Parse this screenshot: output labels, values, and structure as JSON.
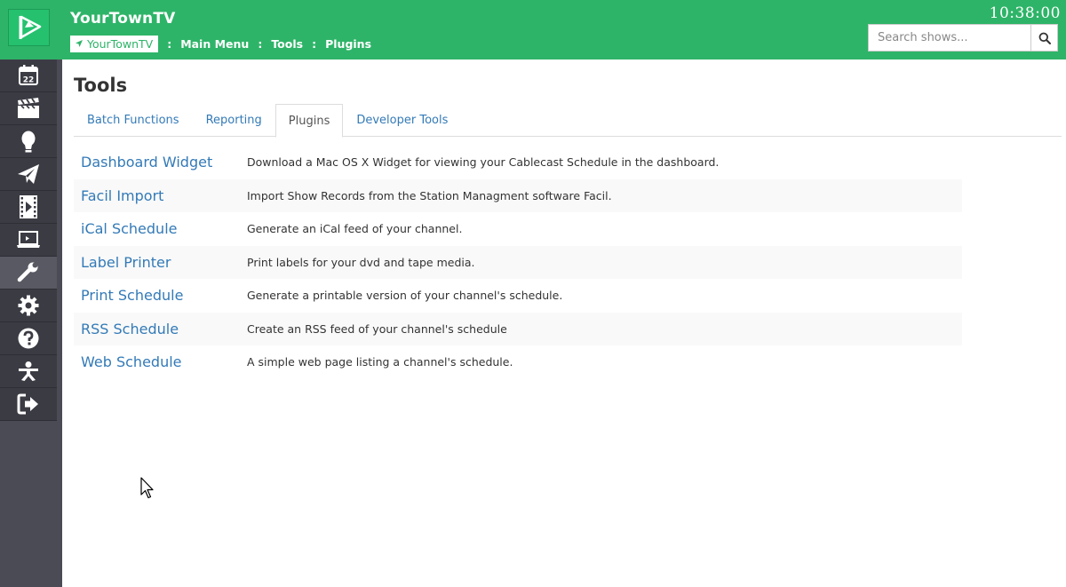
{
  "header": {
    "app_title": "YourTownTV",
    "clock": "10:38:00",
    "brand_color": "#2eb468",
    "logo_icon": "play-flag-logo-icon",
    "breadcrumb": {
      "home": "YourTownTV",
      "separator": ":",
      "items": [
        "Main Menu",
        "Tools",
        "Plugins"
      ]
    },
    "search": {
      "placeholder": "Search shows...",
      "icon": "search-icon"
    }
  },
  "sidebar": {
    "items": [
      {
        "icon": "calendar-icon",
        "calendar_day": "22",
        "active": false
      },
      {
        "icon": "clapperboard-icon",
        "active": false
      },
      {
        "icon": "person-icon",
        "active": false
      },
      {
        "icon": "paper-plane-icon",
        "active": false
      },
      {
        "icon": "film-play-icon",
        "active": false
      },
      {
        "icon": "laptop-icon",
        "active": false
      },
      {
        "icon": "wrench-icon",
        "active": true
      },
      {
        "icon": "gear-icon",
        "active": false
      },
      {
        "icon": "question-icon",
        "active": false
      },
      {
        "icon": "network-icon",
        "active": false
      },
      {
        "icon": "logout-icon",
        "active": false
      }
    ]
  },
  "main": {
    "title": "Tools",
    "tabs": [
      {
        "label": "Batch Functions",
        "active": false
      },
      {
        "label": "Reporting",
        "active": false
      },
      {
        "label": "Plugins",
        "active": true
      },
      {
        "label": "Developer Tools",
        "active": false
      }
    ],
    "plugins": [
      {
        "name": "Dashboard Widget",
        "description": "Download a Mac OS X Widget for viewing your Cablecast Schedule in the dashboard."
      },
      {
        "name": "Facil Import",
        "description": "Import Show Records from the Station Managment software Facil."
      },
      {
        "name": "iCal Schedule",
        "description": "Generate an iCal feed of your channel."
      },
      {
        "name": "Label Printer",
        "description": "Print labels for your dvd and tape media."
      },
      {
        "name": "Print Schedule",
        "description": "Generate a printable version of your channel's schedule."
      },
      {
        "name": "RSS Schedule",
        "description": "Create an RSS feed of your channel's schedule"
      },
      {
        "name": "Web Schedule",
        "description": "A simple web page listing a channel's schedule."
      }
    ]
  }
}
